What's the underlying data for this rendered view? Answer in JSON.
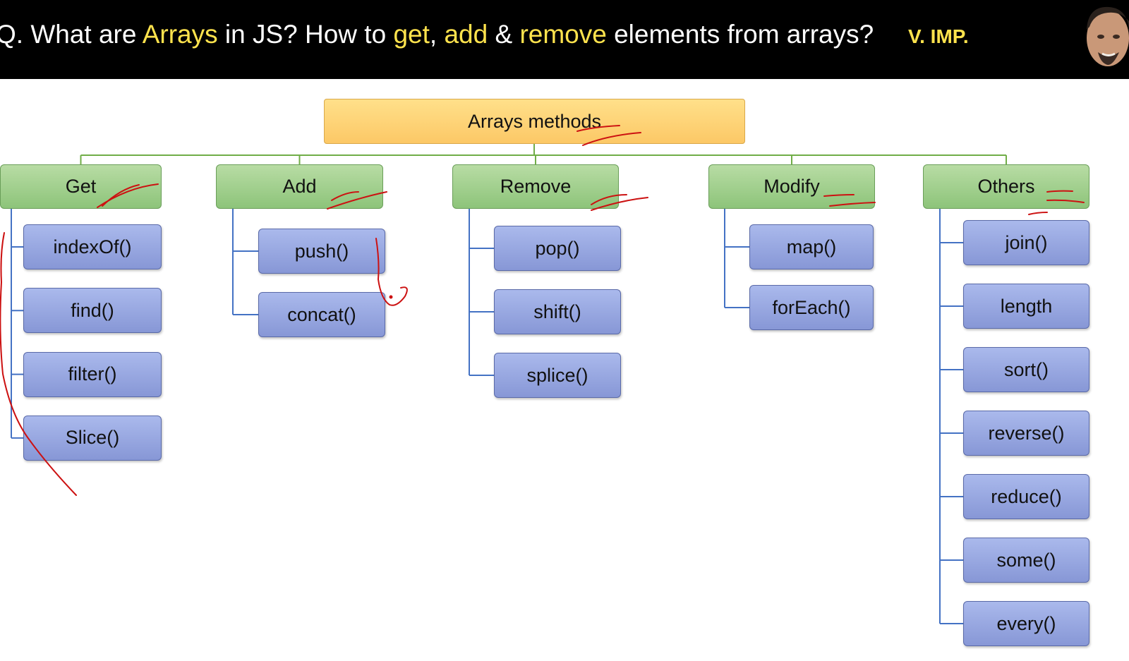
{
  "header": {
    "title_parts": [
      {
        "text": "Q. What are ",
        "highlight": false
      },
      {
        "text": "Arrays",
        "highlight": true
      },
      {
        "text": " in JS? How to ",
        "highlight": false
      },
      {
        "text": "get",
        "highlight": true
      },
      {
        "text": ", ",
        "highlight": false
      },
      {
        "text": "add",
        "highlight": true
      },
      {
        "text": " & ",
        "highlight": false
      },
      {
        "text": "remove",
        "highlight": true
      },
      {
        "text": " elements from arrays?",
        "highlight": false
      }
    ],
    "badge": "V. IMP."
  },
  "diagram": {
    "root": "Arrays methods",
    "categories": [
      {
        "label": "Get",
        "items": [
          "indexOf()",
          "find()",
          "filter()",
          "Slice()"
        ]
      },
      {
        "label": "Add",
        "items": [
          "push()",
          "concat()"
        ]
      },
      {
        "label": "Remove",
        "items": [
          "pop()",
          "shift()",
          "splice()"
        ]
      },
      {
        "label": "Modify",
        "items": [
          "map()",
          "forEach()"
        ]
      },
      {
        "label": "Others",
        "items": [
          "join()",
          "length",
          "sort()",
          "reverse()",
          "reduce()",
          "some()",
          "every()"
        ]
      }
    ]
  },
  "colors": {
    "header_bg": "#000000",
    "highlight": "#ffe34d",
    "root_fill": "#fcd277",
    "category_fill": "#a6d393",
    "item_fill": "#98a8e2",
    "connector_green": "#70ad47",
    "connector_blue": "#4472c4",
    "annotation_red": "#cc1111"
  }
}
